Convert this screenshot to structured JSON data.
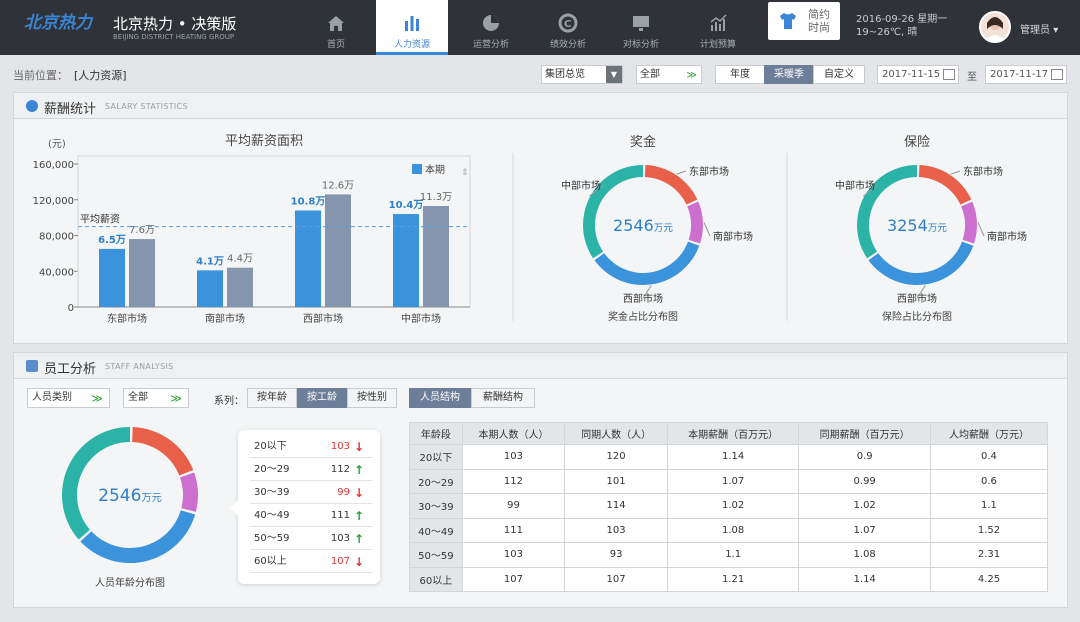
{
  "header": {
    "logo_text": "北京热力",
    "title": "北京热力 • 决策版",
    "subtitle": "BEIJING DISTRICT HEATING GROUP",
    "nav": [
      {
        "label": "首页",
        "icon": "home-icon"
      },
      {
        "label": "人力资源",
        "icon": "bar-chart-icon",
        "active": true
      },
      {
        "label": "运营分析",
        "icon": "pie-icon"
      },
      {
        "label": "绩效分析",
        "icon": "gauge-icon"
      },
      {
        "label": "对标分析",
        "icon": "monitor-icon"
      },
      {
        "label": "计划预算",
        "icon": "trend-icon"
      }
    ],
    "clock_label": "简约时尚",
    "date_line": "2016-09-26 星期一",
    "weather_line": "19~26℃, 晴",
    "user_name": "管理员"
  },
  "toolbar": {
    "breadcrumb_label": "当前位置：",
    "breadcrumb_value": "[人力资源]",
    "group_select": "集团总览",
    "scope_select": "全部",
    "period_tabs": [
      "年度",
      "采暖季",
      "自定义"
    ],
    "period_active": 1,
    "date_from": "2017-11-15",
    "date_to_label": "至",
    "date_to": "2017-11-17"
  },
  "salary": {
    "title": "薪酬统计",
    "subtitle": "SALARY STATISTICS",
    "bar_title": "平均薪资面积",
    "unit_label": "(元)",
    "legend_label": "本期",
    "avg_label": "平均薪资",
    "bonus_title": "奖金",
    "bonus_total": "2546",
    "bonus_unit": "万元",
    "bonus_caption": "奖金占比分布图",
    "insurance_title": "保险",
    "insurance_total": "3254",
    "insurance_unit": "万元",
    "insurance_caption": "保险占比分布图",
    "donut_labels": {
      "east": "东部市场",
      "south": "南部市场",
      "west": "西部市场",
      "center": "中部市场"
    }
  },
  "chart_data": [
    {
      "type": "bar",
      "title": "平均薪资面积",
      "ylabel": "(元)",
      "categories": [
        "东部市场",
        "南部市场",
        "西部市场",
        "中部市场"
      ],
      "series": [
        {
          "name": "本期",
          "values": [
            65000,
            41000,
            108000,
            104000
          ],
          "labels": [
            "6.5万",
            "4.1万",
            "10.8万",
            "10.4万"
          ],
          "color": "#3b93dc"
        },
        {
          "values": [
            76000,
            44000,
            126000,
            113000
          ],
          "labels": [
            "7.6万",
            "4.4万",
            "12.6万",
            "11.3万"
          ],
          "color": "#8595ae"
        }
      ],
      "yticks": [
        "0",
        "40,000",
        "80,000",
        "120,000",
        "160,000"
      ],
      "ylim": [
        0,
        160000
      ],
      "avg_line": 90000
    },
    {
      "type": "pie",
      "title": "奖金",
      "categories": [
        "东部市场",
        "南部市场",
        "西部市场",
        "中部市场"
      ],
      "values": [
        18,
        12,
        35,
        35
      ],
      "colors": [
        "#e8604a",
        "#cc6fcf",
        "#3b93dc",
        "#2bb3a8"
      ]
    },
    {
      "type": "pie",
      "title": "保险",
      "categories": [
        "东部市场",
        "南部市场",
        "西部市场",
        "中部市场"
      ],
      "values": [
        18,
        12,
        35,
        35
      ],
      "colors": [
        "#e8604a",
        "#cc6fcf",
        "#3b93dc",
        "#2bb3a8"
      ]
    },
    {
      "type": "pie",
      "title": "人员年龄分布图",
      "values": [
        19,
        10,
        34,
        37
      ],
      "colors": [
        "#e8604a",
        "#cc6fcf",
        "#3b93dc",
        "#2bb3a8"
      ]
    }
  ],
  "staff": {
    "title": "员工分析",
    "subtitle": "STAFF ANALYSIS",
    "type_select": "人员类别",
    "all_select": "全部",
    "series_label": "系列：",
    "series_tabs": [
      "按年龄",
      "按工龄",
      "按性别"
    ],
    "series_active": 1,
    "struct_tabs": [
      "人员结构",
      "薪酬结构"
    ],
    "struct_active": 0,
    "donut_total": "2546",
    "donut_unit": "万元",
    "donut_caption": "人员年龄分布图",
    "list": [
      {
        "label": "20以下",
        "value": "103",
        "dir": "down"
      },
      {
        "label": "20～29",
        "value": "112",
        "dir": "up"
      },
      {
        "label": "30～39",
        "value": "99",
        "dir": "down"
      },
      {
        "label": "40～49",
        "value": "111",
        "dir": "up"
      },
      {
        "label": "50～59",
        "value": "103",
        "dir": "up"
      },
      {
        "label": "60以上",
        "value": "107",
        "dir": "down"
      }
    ],
    "table_headers": [
      "年龄段",
      "本期人数（人）",
      "同期人数（人）",
      "本期薪酬（百万元）",
      "同期薪酬（百万元）",
      "人均薪酬（万元）"
    ],
    "table_rows": [
      [
        "20以下",
        "103",
        "120",
        "1.14",
        "0.9",
        "0.4"
      ],
      [
        "20～29",
        "112",
        "101",
        "1.07",
        "0.99",
        "0.6"
      ],
      [
        "30～39",
        "99",
        "114",
        "1.02",
        "1.02",
        "1.1"
      ],
      [
        "40～49",
        "111",
        "103",
        "1.08",
        "1.07",
        "1.52"
      ],
      [
        "50～59",
        "103",
        "93",
        "1.1",
        "1.08",
        "2.31"
      ],
      [
        "60以上",
        "107",
        "107",
        "1.21",
        "1.14",
        "4.25"
      ]
    ]
  }
}
